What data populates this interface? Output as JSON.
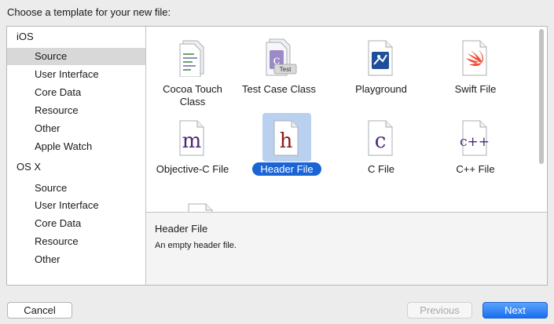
{
  "header": {
    "title": "Choose a template for your new file:"
  },
  "sidebar": {
    "groups": [
      {
        "label": "iOS",
        "items": [
          "Source",
          "User Interface",
          "Core Data",
          "Resource",
          "Other",
          "Apple Watch"
        ]
      },
      {
        "label": "OS X",
        "items": [
          "Source",
          "User Interface",
          "Core Data",
          "Resource",
          "Other"
        ]
      }
    ],
    "selected": "iOS / Source"
  },
  "templates": [
    {
      "label": "Cocoa Touch Class",
      "icon": "cocoa-touch-class-icon"
    },
    {
      "label": "Test Case Class",
      "icon": "test-case-class-icon",
      "badge": "Test"
    },
    {
      "label": "Playground",
      "icon": "playground-icon"
    },
    {
      "label": "Swift File",
      "icon": "swift-file-icon"
    },
    {
      "label": "Objective-C File",
      "icon": "objective-c-file-icon",
      "glyph": "m"
    },
    {
      "label": "Header File",
      "icon": "header-file-icon",
      "glyph": "h",
      "selected": true
    },
    {
      "label": "C File",
      "icon": "c-file-icon",
      "glyph": "c"
    },
    {
      "label": "C++ File",
      "icon": "cpp-file-icon",
      "glyph": "c++"
    }
  ],
  "description": {
    "title": "Header File",
    "text": "An empty header file."
  },
  "buttons": {
    "cancel": "Cancel",
    "previous": "Previous",
    "next": "Next"
  },
  "colors": {
    "accent": "#1a64d6",
    "selection": "#b9d0ef",
    "glyph_purple": "#4a2a7a",
    "glyph_red": "#8b1a1a",
    "swift": "#f05138",
    "playground": "#1e4f9a"
  }
}
